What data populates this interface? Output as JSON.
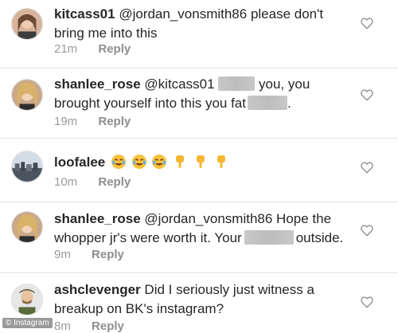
{
  "comments": [
    {
      "username": "kitcass01",
      "text_1": "@jordan_vonsmith86 please don't",
      "text_2": "bring me into this",
      "time": "21m",
      "reply": "Reply"
    },
    {
      "username": "shanlee_rose",
      "text_1": "@kitcass01",
      "text_1b": "you, you",
      "text_2": "brought yourself into this you fat",
      "text_2b": ".",
      "time": "19m",
      "reply": "Reply"
    },
    {
      "username": "loofalee",
      "emojis": [
        "face-with-tears-of-joy",
        "face-with-tears-of-joy",
        "face-with-tears-of-joy",
        "pointing-down-hand",
        "pointing-down-hand",
        "pointing-down-hand"
      ],
      "time": "10m",
      "reply": "Reply"
    },
    {
      "username": "shanlee_rose",
      "text_1": "@jordan_vonsmith86 Hope the",
      "text_2": "whopper jr's were worth it. Your",
      "text_2b": "outside.",
      "time": "9m",
      "reply": "Reply"
    },
    {
      "username": "ashclevenger",
      "text_1": "Did I seriously just witness a",
      "text_2": "breakup on BK's instagram?",
      "time": "8m",
      "reply": "Reply"
    }
  ],
  "watermark": "© Instagram",
  "colors": {
    "text": "#262626",
    "meta": "#9b9b9b",
    "divider": "#e4e4e4",
    "redaction": "#c4c4c4"
  },
  "icons": {
    "like": "heart-outline-icon"
  }
}
